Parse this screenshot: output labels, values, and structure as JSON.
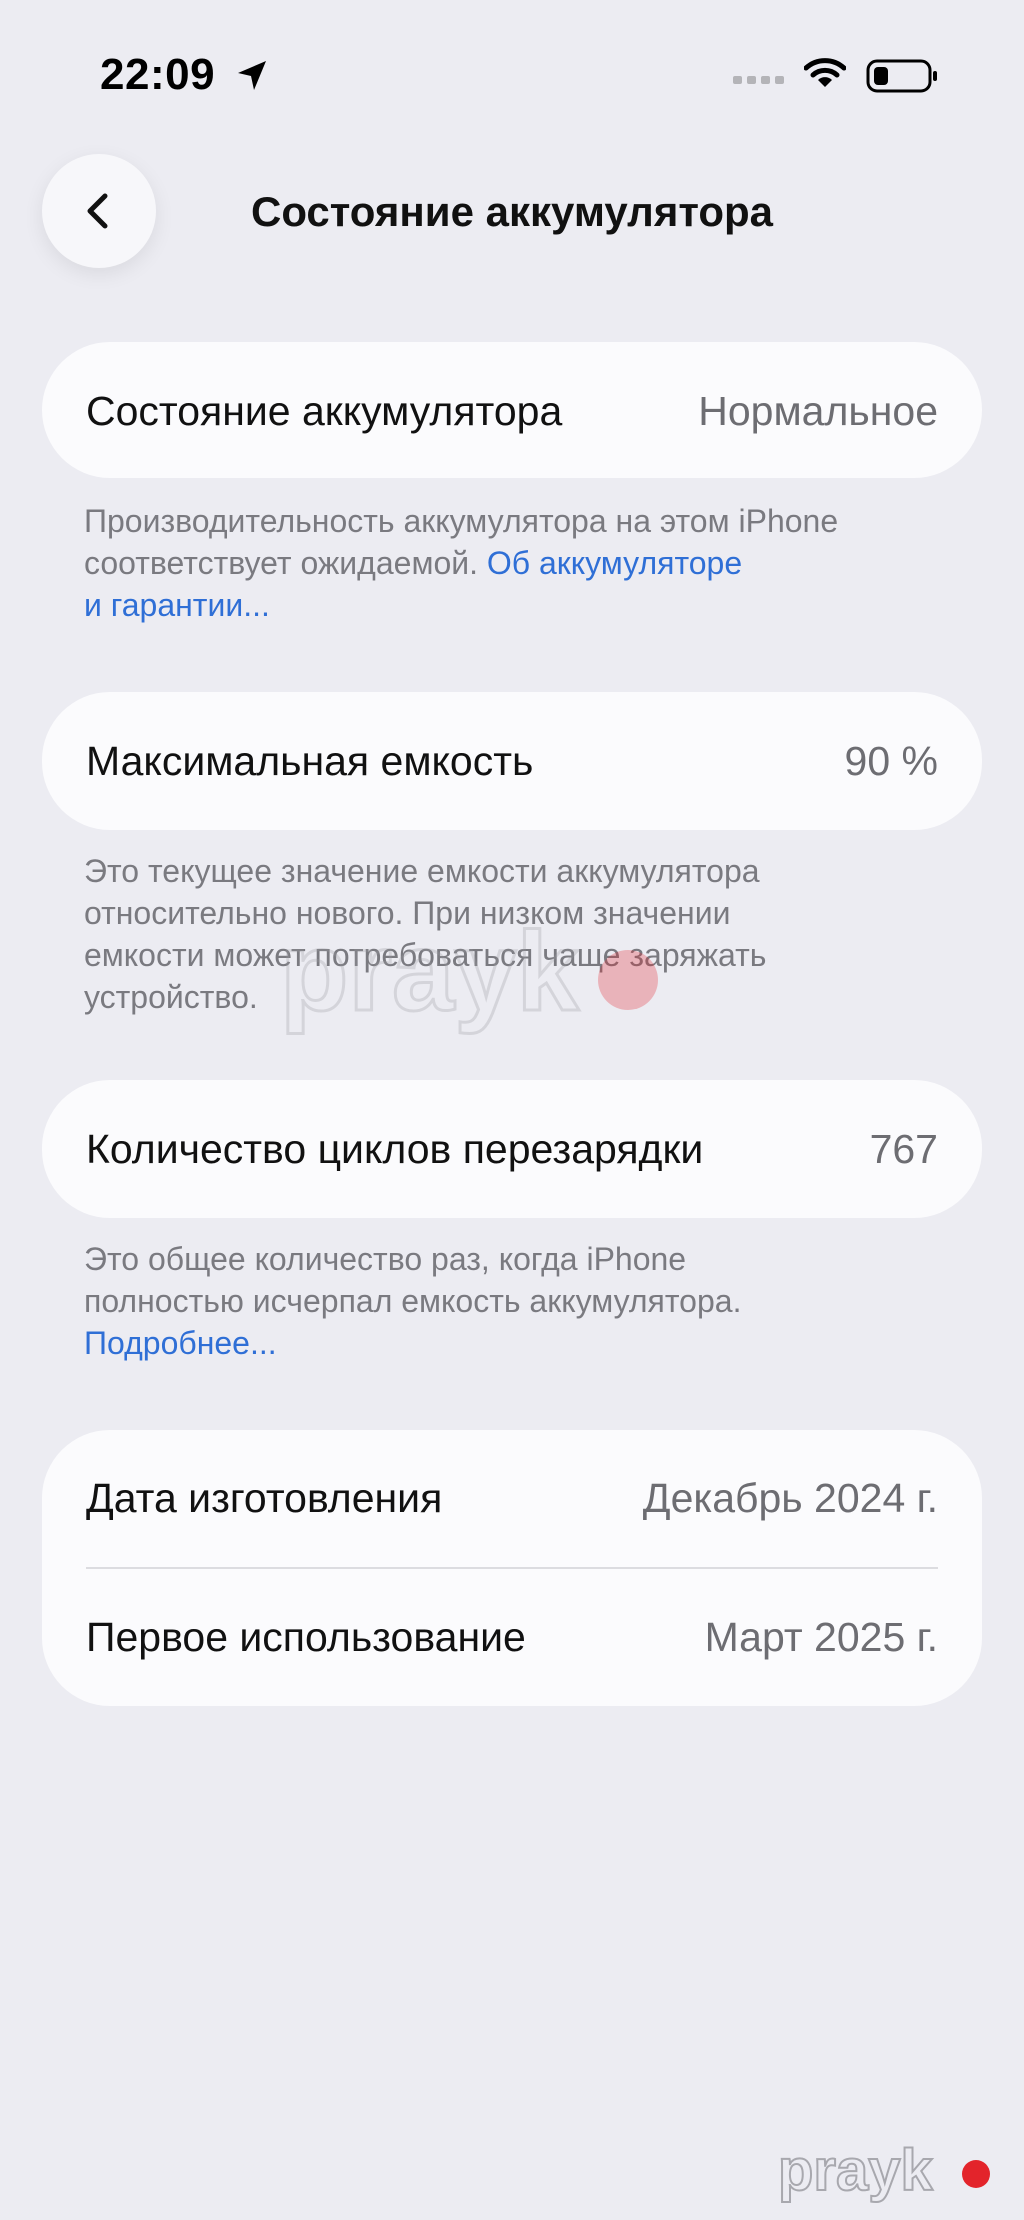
{
  "status_bar": {
    "time": "22:09",
    "icons": [
      "location-arrow-icon",
      "cellular-signal-icon",
      "wifi-icon",
      "battery-low-icon"
    ]
  },
  "nav": {
    "back_icon": "chevron-left-icon",
    "title": "Состояние аккумулятора"
  },
  "battery_health": {
    "label": "Состояние аккумулятора",
    "value": "Нормальное",
    "note_line1": "Производительность аккумулятора на этом iPhone",
    "note_line2": "соответствует ожидаемой.",
    "link_part1": "Об аккумуляторе",
    "link_part2": "и гарантии..."
  },
  "max_capacity": {
    "label": "Максимальная емкость",
    "value": "90 %",
    "note_line1": "Это текущее значение емкости аккумулятора",
    "note_line2": "относительно нового. При низком значении",
    "note_line3": "емкости может потребоваться чаще заряжать",
    "note_line4": "устройство."
  },
  "cycle_count": {
    "label": "Количество циклов перезарядки",
    "value": "767",
    "note_line1": "Это общее количество раз, когда iPhone",
    "note_line2": "полностью исчерпал емкость аккумулятора.",
    "link": "Подробнее..."
  },
  "dates": {
    "manufacture_label": "Дата изготовления",
    "manufacture_value": "Декабрь 2024 г.",
    "first_use_label": "Первое использование",
    "first_use_value": "Март 2025 г."
  },
  "watermark": {
    "text": "prayk"
  },
  "colors": {
    "background": "#ececf2",
    "card": "#fbfbfd",
    "link": "#2f6fd6",
    "secondary_text": "#6d6d72",
    "watermark_dot": "#e3242b"
  }
}
